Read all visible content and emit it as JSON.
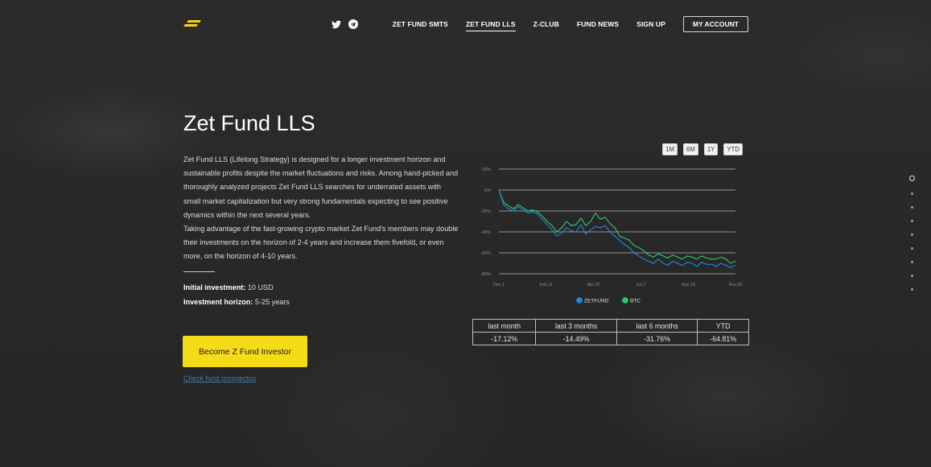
{
  "nav": {
    "items": [
      {
        "label": "ZET FUND SMTS",
        "active": false
      },
      {
        "label": "ZET FUND LLS",
        "active": true
      },
      {
        "label": "Z-CLUB",
        "active": false
      },
      {
        "label": "FUND NEWS",
        "active": false
      },
      {
        "label": "SIGN UP",
        "active": false
      }
    ],
    "account": "MY ACCOUNT",
    "social_icons": [
      "twitter-icon",
      "telegram-icon"
    ]
  },
  "hero": {
    "title": "Zet Fund LLS",
    "description_1": "Zet Fund LLS (Lifelong Strategy) is designed for a longer investment horizon and sustainable profits despite the market fluctuations and risks. Among hand-picked and thoroughly analyzed projects Zet Fund LLS searches for underrated assets with small market capitalization but very strong fundamentals expecting to see positive dynamics within the next several years.",
    "description_2": "Taking advantage of the fast-growing crypto market Zet Fund's members may double their investments on the horizon of 2-4 years and increase them fivefold, or even more, on the horizon of 4-10 years.",
    "initial_label": "Initial investment:",
    "initial_value": " 10 USD",
    "horizon_label": "Investment horizon:",
    "horizon_value": " 5-25 years",
    "cta": "Become Z Fund Investor",
    "prospectus": "Check fund prospectus"
  },
  "periods": [
    "1M",
    "6M",
    "1Y",
    "YTD"
  ],
  "performance": {
    "headers": [
      "last month",
      "last 3 months",
      "last 6 months",
      "YTD"
    ],
    "values": [
      "-17.12%",
      "-14.49%",
      "-31.76%",
      "-64.81%"
    ]
  },
  "colors": {
    "accent": "#f5dc19",
    "zetfund": "#1e88e5",
    "btc": "#2ecc71"
  },
  "chart_data": {
    "type": "line",
    "yticks": [
      "20%",
      "0%",
      "-20%",
      "-40%",
      "-60%",
      "-80%"
    ],
    "ylim": [
      -80,
      20
    ],
    "xticks": [
      "Dec,1",
      "Feb,11",
      "Apr,25",
      "Jul,7",
      "Sep,18",
      "Nov,30"
    ],
    "legend": [
      "ZETFUND",
      "BTC"
    ],
    "series": [
      {
        "name": "ZETFUND",
        "values": [
          0,
          -14,
          -18,
          -20,
          -16,
          -19,
          -22,
          -21,
          -23,
          -28,
          -33,
          -38,
          -44,
          -41,
          -36,
          -39,
          -40,
          -33,
          -42,
          -38,
          -35,
          -36,
          -34,
          -40,
          -44,
          -48,
          -52,
          -55,
          -60,
          -63,
          -66,
          -68,
          -70,
          -66,
          -70,
          -72,
          -68,
          -70,
          -72,
          -69,
          -70,
          -73,
          -69,
          -71,
          -71,
          -73,
          -70,
          -72,
          -74,
          -72
        ]
      },
      {
        "name": "BTC",
        "values": [
          0,
          -12,
          -15,
          -18,
          -14,
          -17,
          -20,
          -19,
          -21,
          -25,
          -30,
          -34,
          -40,
          -36,
          -30,
          -34,
          -33,
          -27,
          -34,
          -30,
          -22,
          -28,
          -26,
          -32,
          -36,
          -44,
          -46,
          -48,
          -53,
          -55,
          -58,
          -62,
          -64,
          -61,
          -63,
          -65,
          -62,
          -64,
          -66,
          -63,
          -64,
          -66,
          -63,
          -65,
          -66,
          -66,
          -64,
          -66,
          -70,
          -68
        ]
      }
    ]
  }
}
